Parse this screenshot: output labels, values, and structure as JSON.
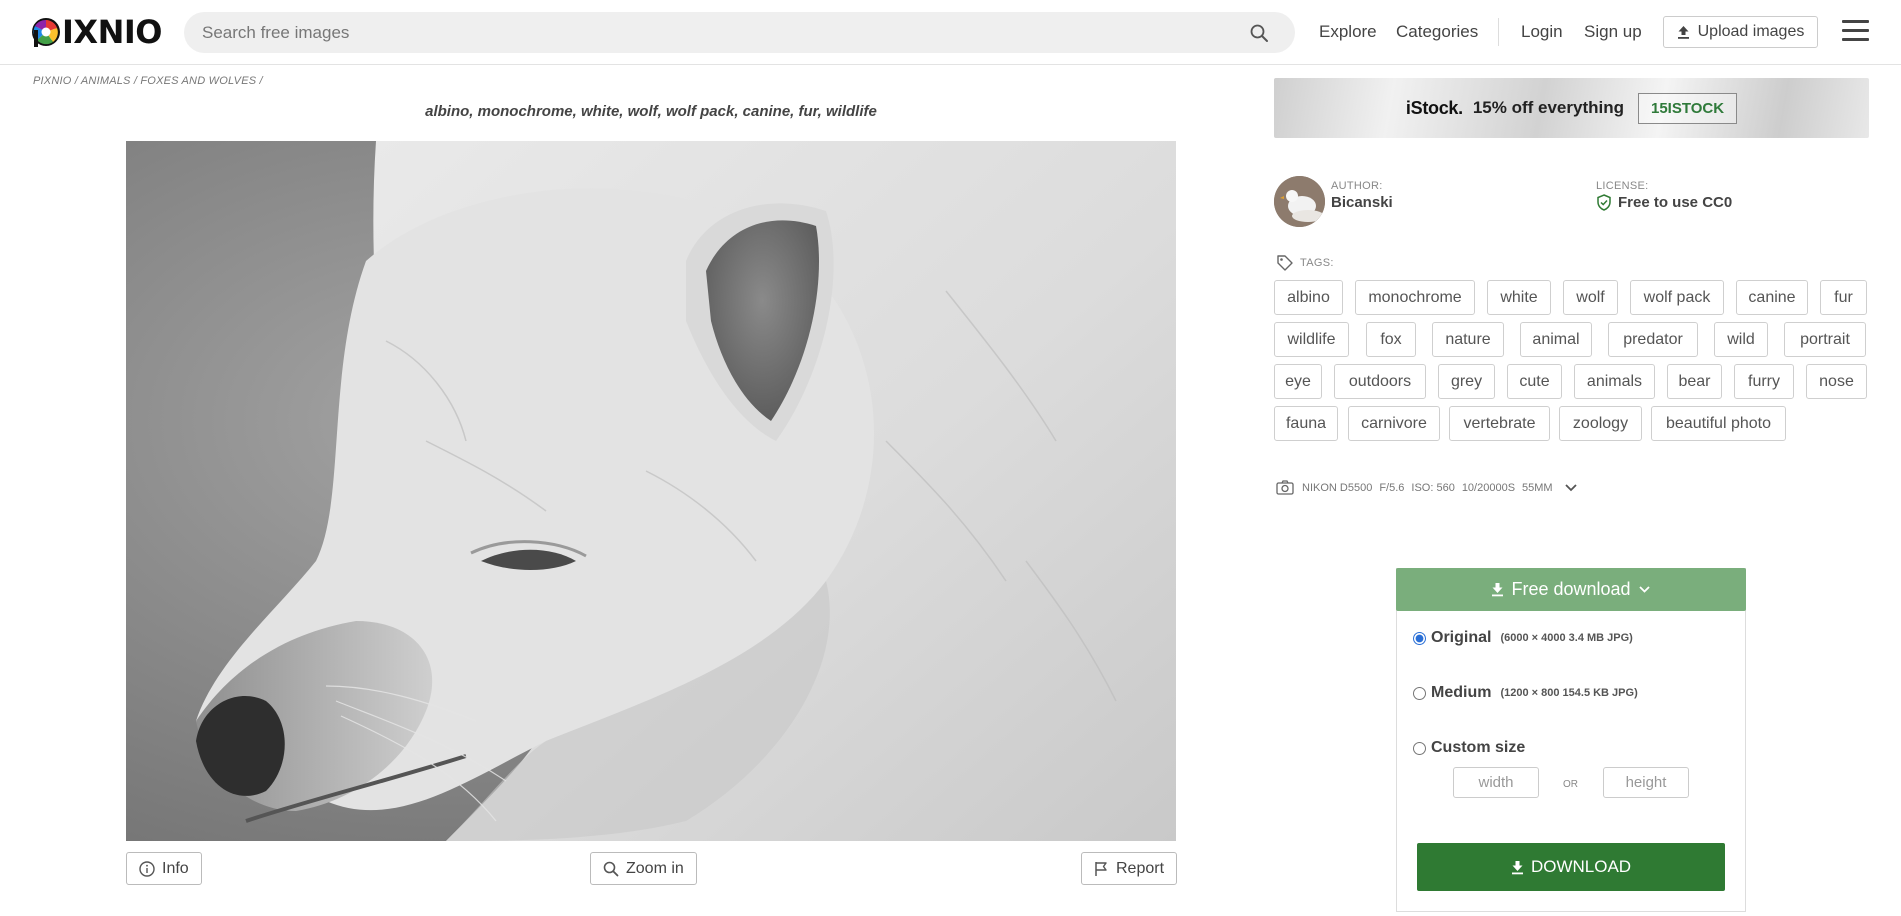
{
  "header": {
    "logo_text": "IXNIO",
    "search_placeholder": "Search free images",
    "nav": {
      "explore": "Explore",
      "categories": "Categories",
      "login": "Login",
      "signup": "Sign up",
      "upload": "Upload images"
    }
  },
  "breadcrumb": {
    "items": [
      "PIXNIO",
      "ANIMALS",
      "FOXES AND WOLVES"
    ],
    "separator": "/"
  },
  "image": {
    "title": "albino, monochrome, white, wolf, wolf pack, canine, fur, wildlife"
  },
  "image_actions": {
    "info": "Info",
    "zoom": "Zoom in",
    "report": "Report"
  },
  "ad": {
    "brand": "iStock.",
    "text": "15% off everything",
    "code": "15ISTOCK"
  },
  "author": {
    "label": "AUTHOR:",
    "name": "Bicanski"
  },
  "license": {
    "label": "LICENSE:",
    "value": "Free to use CC0"
  },
  "tags": {
    "label": "TAGS:",
    "items": [
      "albino",
      "monochrome",
      "white",
      "wolf",
      "wolf pack",
      "canine",
      "fur",
      "wildlife",
      "fox",
      "nature",
      "animal",
      "predator",
      "wild",
      "portrait",
      "eye",
      "outdoors",
      "grey",
      "cute",
      "animals",
      "bear",
      "furry",
      "nose",
      "fauna",
      "carnivore",
      "vertebrate",
      "zoology",
      "beautiful photo"
    ]
  },
  "exif": {
    "camera": "NIKON D5500",
    "aperture": "F/5.6",
    "iso": "ISO: 560",
    "shutter": "10/20000S",
    "focal": "55MM"
  },
  "download": {
    "free_label": "Free download",
    "options": [
      {
        "name": "Original",
        "detail": "(6000 × 4000  3.4 MB  JPG)",
        "selected": true
      },
      {
        "name": "Medium",
        "detail": "(1200 × 800  154.5 KB  JPG)",
        "selected": false
      },
      {
        "name": "Custom size",
        "detail": "",
        "selected": false
      }
    ],
    "width_placeholder": "width",
    "or": "OR",
    "height_placeholder": "height",
    "button": "DOWNLOAD"
  },
  "colors": {
    "accent_green": "#2f7a33",
    "light_green": "#7aae7c",
    "promo_code_green": "#2f7a3a"
  }
}
